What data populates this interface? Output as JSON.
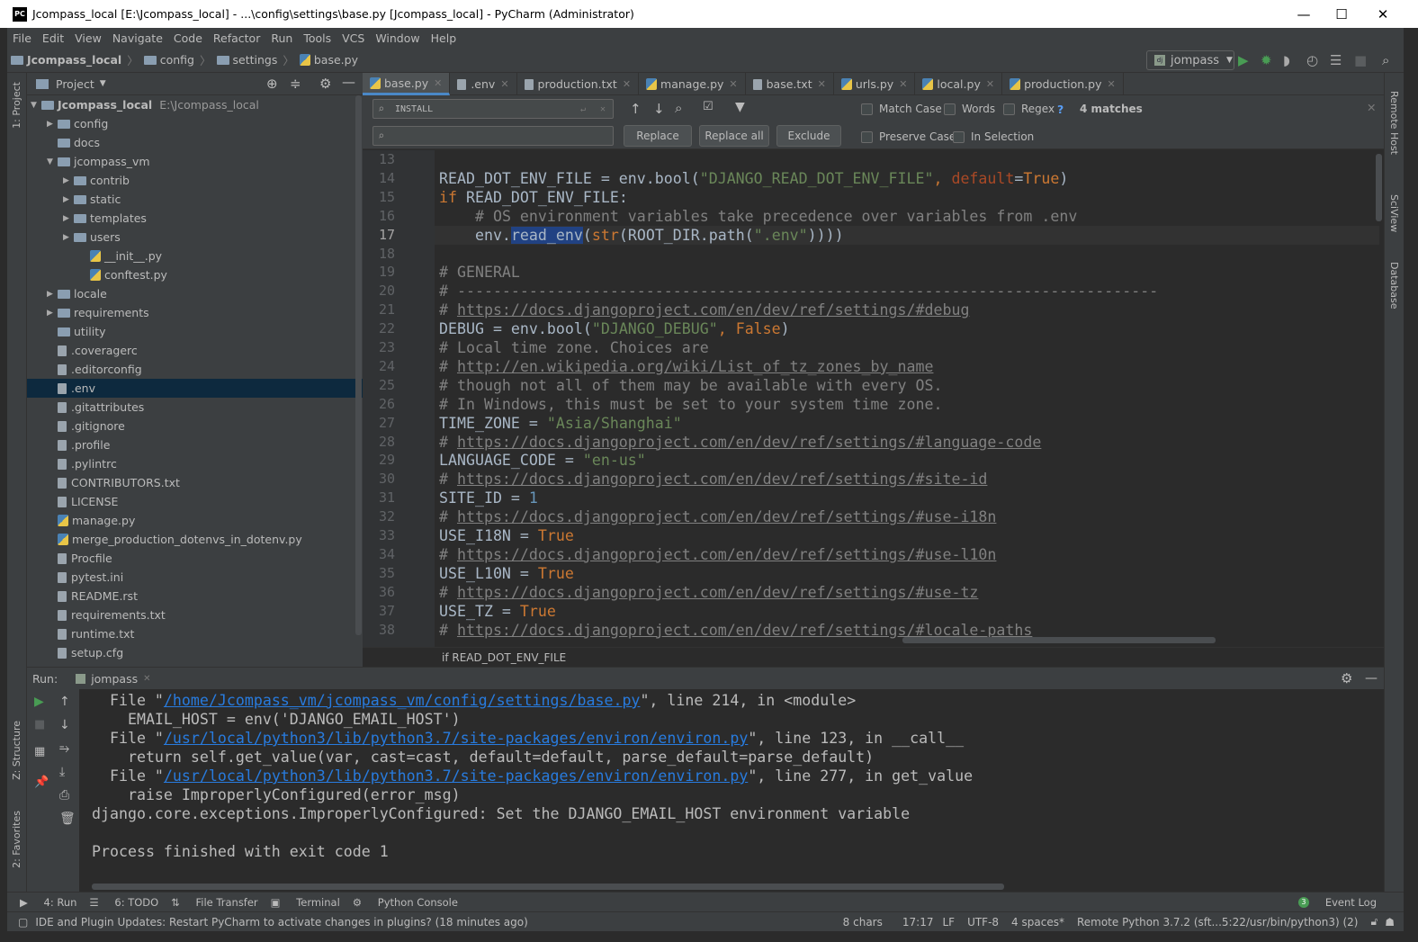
{
  "window": {
    "title": "Jcompass_local [E:\\Jcompass_local] - ...\\config\\settings\\base.py [Jcompass_local] - PyCharm (Administrator)",
    "minimize": "—",
    "maximize": "☐",
    "close": "✕"
  },
  "menu": [
    "File",
    "Edit",
    "View",
    "Navigate",
    "Code",
    "Refactor",
    "Run",
    "Tools",
    "VCS",
    "Window",
    "Help"
  ],
  "nav": {
    "crumbs": [
      "Jcompass_local",
      "config",
      "settings",
      "base.py"
    ],
    "run_config": "jompass"
  },
  "project": {
    "title": "Project",
    "root": "Jcompass_local",
    "root_path": "E:\\Jcompass_local",
    "items": [
      {
        "label": "config",
        "level": 1,
        "kind": "folder",
        "expand": "closed"
      },
      {
        "label": "docs",
        "level": 1,
        "kind": "folder",
        "expand": "none"
      },
      {
        "label": "jcompass_vm",
        "level": 1,
        "kind": "folder",
        "expand": "open"
      },
      {
        "label": "contrib",
        "level": 2,
        "kind": "folder",
        "expand": "closed"
      },
      {
        "label": "static",
        "level": 2,
        "kind": "folder",
        "expand": "closed"
      },
      {
        "label": "templates",
        "level": 2,
        "kind": "folder",
        "expand": "closed"
      },
      {
        "label": "users",
        "level": 2,
        "kind": "folder",
        "expand": "closed"
      },
      {
        "label": "__init__.py",
        "level": 3,
        "kind": "py",
        "expand": "none"
      },
      {
        "label": "conftest.py",
        "level": 3,
        "kind": "py",
        "expand": "none"
      },
      {
        "label": "locale",
        "level": 1,
        "kind": "folder",
        "expand": "closed"
      },
      {
        "label": "requirements",
        "level": 1,
        "kind": "folder",
        "expand": "closed"
      },
      {
        "label": "utility",
        "level": 1,
        "kind": "folder",
        "expand": "none"
      },
      {
        "label": ".coveragerc",
        "level": 1,
        "kind": "file",
        "expand": "none"
      },
      {
        "label": ".editorconfig",
        "level": 1,
        "kind": "file",
        "expand": "none"
      },
      {
        "label": ".env",
        "level": 1,
        "kind": "file",
        "expand": "none",
        "selected": true
      },
      {
        "label": ".gitattributes",
        "level": 1,
        "kind": "file",
        "expand": "none"
      },
      {
        "label": ".gitignore",
        "level": 1,
        "kind": "file",
        "expand": "none"
      },
      {
        "label": ".profile",
        "level": 1,
        "kind": "file",
        "expand": "none"
      },
      {
        "label": ".pylintrc",
        "level": 1,
        "kind": "file",
        "expand": "none"
      },
      {
        "label": "CONTRIBUTORS.txt",
        "level": 1,
        "kind": "file",
        "expand": "none"
      },
      {
        "label": "LICENSE",
        "level": 1,
        "kind": "file",
        "expand": "none"
      },
      {
        "label": "manage.py",
        "level": 1,
        "kind": "py",
        "expand": "none"
      },
      {
        "label": "merge_production_dotenvs_in_dotenv.py",
        "level": 1,
        "kind": "py",
        "expand": "none"
      },
      {
        "label": "Procfile",
        "level": 1,
        "kind": "file",
        "expand": "none"
      },
      {
        "label": "pytest.ini",
        "level": 1,
        "kind": "file",
        "expand": "none"
      },
      {
        "label": "README.rst",
        "level": 1,
        "kind": "file",
        "expand": "none"
      },
      {
        "label": "requirements.txt",
        "level": 1,
        "kind": "file",
        "expand": "none"
      },
      {
        "label": "runtime.txt",
        "level": 1,
        "kind": "file",
        "expand": "none"
      },
      {
        "label": "setup.cfg",
        "level": 1,
        "kind": "file",
        "expand": "none"
      }
    ]
  },
  "tabs": [
    {
      "label": "base.py",
      "kind": "py",
      "active": true
    },
    {
      "label": ".env",
      "kind": "file"
    },
    {
      "label": "production.txt",
      "kind": "file"
    },
    {
      "label": "manage.py",
      "kind": "py"
    },
    {
      "label": "base.txt",
      "kind": "file"
    },
    {
      "label": "urls.py",
      "kind": "py"
    },
    {
      "label": "local.py",
      "kind": "py"
    },
    {
      "label": "production.py",
      "kind": "py"
    }
  ],
  "find": {
    "search_value": "INSTALL",
    "replace_value": "",
    "replace": "Replace",
    "replace_all": "Replace all",
    "exclude": "Exclude",
    "match_case": "Match Case",
    "words": "Words",
    "regex": "Regex",
    "help": "?",
    "matches": "4 matches",
    "preserve_case": "Preserve Case",
    "in_selection": "In Selection"
  },
  "editor": {
    "first_line": 13,
    "current_line": 17,
    "breadcrumb": "if READ_DOT_ENV_FILE",
    "lines": [
      [],
      [
        [
          "p",
          "READ_DOT_ENV_FILE = env.bool("
        ],
        [
          "str",
          "\"DJANGO_READ_DOT_ENV_FILE\""
        ],
        [
          "kw",
          ", "
        ],
        [
          "kwarg",
          "default"
        ],
        [
          "p",
          "="
        ],
        [
          "kw",
          "True"
        ],
        [
          "p",
          ")"
        ]
      ],
      [
        [
          "kw",
          "if "
        ],
        [
          "p",
          "READ_DOT_ENV_FILE:"
        ]
      ],
      [
        [
          "p",
          "    "
        ],
        [
          "cm",
          "# OS environment variables take precedence over variables from .env"
        ]
      ],
      [
        [
          "p",
          "    env."
        ],
        [
          "hl",
          "read_env"
        ],
        [
          "p",
          "("
        ],
        [
          "kw2",
          "str"
        ],
        [
          "p",
          "(ROOT_DIR.path("
        ],
        [
          "str",
          "\".env\""
        ],
        [
          "p",
          "))))"
        ]
      ],
      [],
      [
        [
          "cm",
          "# GENERAL"
        ]
      ],
      [
        [
          "cm",
          "# ------------------------------------------------------------------------------"
        ]
      ],
      [
        [
          "cm",
          "# "
        ],
        [
          "link",
          "https://docs.djangoproject.com/en/dev/ref/settings/#debug"
        ]
      ],
      [
        [
          "p",
          "DEBUG = env.bool("
        ],
        [
          "str",
          "\"DJANGO_DEBUG\""
        ],
        [
          "kw",
          ", "
        ],
        [
          "kw",
          "False"
        ],
        [
          "p",
          ")"
        ]
      ],
      [
        [
          "cm",
          "# Local time zone. Choices are"
        ]
      ],
      [
        [
          "cm",
          "# "
        ],
        [
          "link",
          "http://en.wikipedia.org/wiki/List_of_tz_zones_by_name"
        ]
      ],
      [
        [
          "cm",
          "# though not all of them may be available with every OS."
        ]
      ],
      [
        [
          "cm",
          "# In Windows, this must be set to your system time zone."
        ]
      ],
      [
        [
          "p",
          "TIME_ZONE = "
        ],
        [
          "str",
          "\"Asia/Shanghai\""
        ]
      ],
      [
        [
          "cm",
          "# "
        ],
        [
          "link",
          "https://docs.djangoproject.com/en/dev/ref/settings/#language-code"
        ]
      ],
      [
        [
          "p",
          "LANGUAGE_CODE = "
        ],
        [
          "str",
          "\"en-us\""
        ]
      ],
      [
        [
          "cm",
          "# "
        ],
        [
          "link",
          "https://docs.djangoproject.com/en/dev/ref/settings/#site-id"
        ]
      ],
      [
        [
          "p",
          "SITE_ID = "
        ],
        [
          "num",
          "1"
        ]
      ],
      [
        [
          "cm",
          "# "
        ],
        [
          "link",
          "https://docs.djangoproject.com/en/dev/ref/settings/#use-i18n"
        ]
      ],
      [
        [
          "p",
          "USE_I18N = "
        ],
        [
          "kw",
          "True"
        ]
      ],
      [
        [
          "cm",
          "# "
        ],
        [
          "link",
          "https://docs.djangoproject.com/en/dev/ref/settings/#use-l10n"
        ]
      ],
      [
        [
          "p",
          "USE_L10N = "
        ],
        [
          "kw",
          "True"
        ]
      ],
      [
        [
          "cm",
          "# "
        ],
        [
          "link",
          "https://docs.djangoproject.com/en/dev/ref/settings/#use-tz"
        ]
      ],
      [
        [
          "p",
          "USE_TZ = "
        ],
        [
          "kw",
          "True"
        ]
      ],
      [
        [
          "cm",
          "# "
        ],
        [
          "link",
          "https://docs.djangoproject.com/en/dev/ref/settings/#locale-paths"
        ]
      ]
    ]
  },
  "run": {
    "label": "Run:",
    "tab": "jompass",
    "console": [
      [
        [
          "p",
          "  File \""
        ],
        [
          "a",
          "/home/Jcompass_vm/jcompass_vm/config/settings/base.py"
        ],
        [
          "p",
          "\", line 214, in <module>"
        ]
      ],
      [
        [
          "p",
          "    EMAIL_HOST = env('DJANGO_EMAIL_HOST')"
        ]
      ],
      [
        [
          "p",
          "  File \""
        ],
        [
          "a",
          "/usr/local/python3/lib/python3.7/site-packages/environ/environ.py"
        ],
        [
          "p",
          "\", line 123, in __call__"
        ]
      ],
      [
        [
          "p",
          "    return self.get_value(var, cast=cast, default=default, parse_default=parse_default)"
        ]
      ],
      [
        [
          "p",
          "  File \""
        ],
        [
          "a",
          "/usr/local/python3/lib/python3.7/site-packages/environ/environ.py"
        ],
        [
          "p",
          "\", line 277, in get_value"
        ]
      ],
      [
        [
          "p",
          "    raise ImproperlyConfigured(error_msg)"
        ]
      ],
      [
        [
          "p",
          "django.core.exceptions.ImproperlyConfigured: Set the DJANGO_EMAIL_HOST environment variable"
        ]
      ],
      [],
      [
        [
          "p",
          "Process finished with exit code 1"
        ]
      ]
    ]
  },
  "left_strip": {
    "project": "1: Project",
    "structure": "Z: Structure",
    "favorites": "2: Favorites"
  },
  "right_strip": {
    "remote": "Remote Host",
    "sciview": "SciView",
    "database": "Database"
  },
  "bottom_tools": [
    "4: Run",
    "6: TODO",
    "File Transfer",
    "Terminal",
    "Python Console"
  ],
  "event_log": {
    "count": "3",
    "label": "Event Log"
  },
  "status": {
    "message": "IDE and Plugin Updates: Restart PyCharm to activate changes in plugins? (18 minutes ago)",
    "chars": "8 chars",
    "position": "17:17",
    "line_sep": "LF",
    "encoding": "UTF-8",
    "indent": "4 spaces*",
    "interpreter": "Remote Python 3.7.2 (sft...5:22/usr/bin/python3) (2)"
  },
  "colors": {
    "accent": "#4a88c7",
    "keyword": "#cc7832",
    "string": "#6a8759",
    "comment": "#808080",
    "link": "#287bde",
    "run_green": "#499c54"
  }
}
